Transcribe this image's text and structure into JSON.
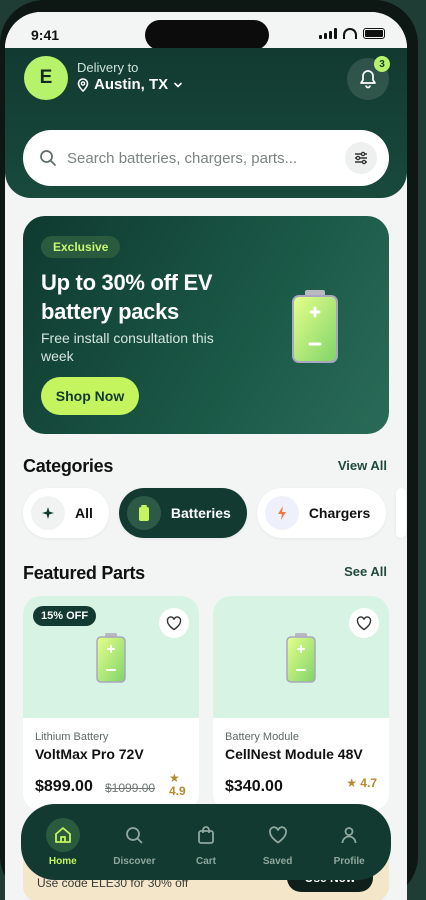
{
  "status": {
    "time": "9:41"
  },
  "header": {
    "avatar_initial": "E",
    "delivery_label": "Delivery to",
    "location": "Austin, TX",
    "notification_count": "3",
    "search_placeholder": "Search batteries, chargers, parts..."
  },
  "promo": {
    "tag": "Exclusive",
    "title": "Up to 30% off EV battery packs",
    "subtitle": "Free install consultation this week",
    "button": "Shop Now"
  },
  "categories": {
    "title": "Categories",
    "link": "View All",
    "items": [
      {
        "label": "All",
        "icon": "sparkle-icon"
      },
      {
        "label": "Batteries",
        "icon": "battery-icon",
        "active": true
      },
      {
        "label": "Chargers",
        "icon": "bolt-icon"
      }
    ]
  },
  "featured": {
    "title": "Featured Parts",
    "link": "See All",
    "items": [
      {
        "discount": "15% OFF",
        "category": "Lithium Battery",
        "name": "VoltMax Pro 72V",
        "price": "$899.00",
        "old_price": "$1099.00",
        "rating": "★ 4.9"
      },
      {
        "category": "Battery Module",
        "name": "CellNest Module 48V",
        "price": "$340.00",
        "rating": "★ 4.7"
      }
    ]
  },
  "banner": {
    "text": "Use code ELE30 for 30% off",
    "button": "Use Now"
  },
  "nav": {
    "items": [
      {
        "label": "Home",
        "icon": "home-icon",
        "active": true
      },
      {
        "label": "Discover",
        "icon": "search-icon"
      },
      {
        "label": "Cart",
        "icon": "cart-icon"
      },
      {
        "label": "Saved",
        "icon": "heart-icon"
      },
      {
        "label": "Profile",
        "icon": "profile-icon"
      }
    ]
  },
  "colors": {
    "primary": "#123a30",
    "accent": "#c4f55e",
    "card_bg": "#d7f3e3"
  }
}
